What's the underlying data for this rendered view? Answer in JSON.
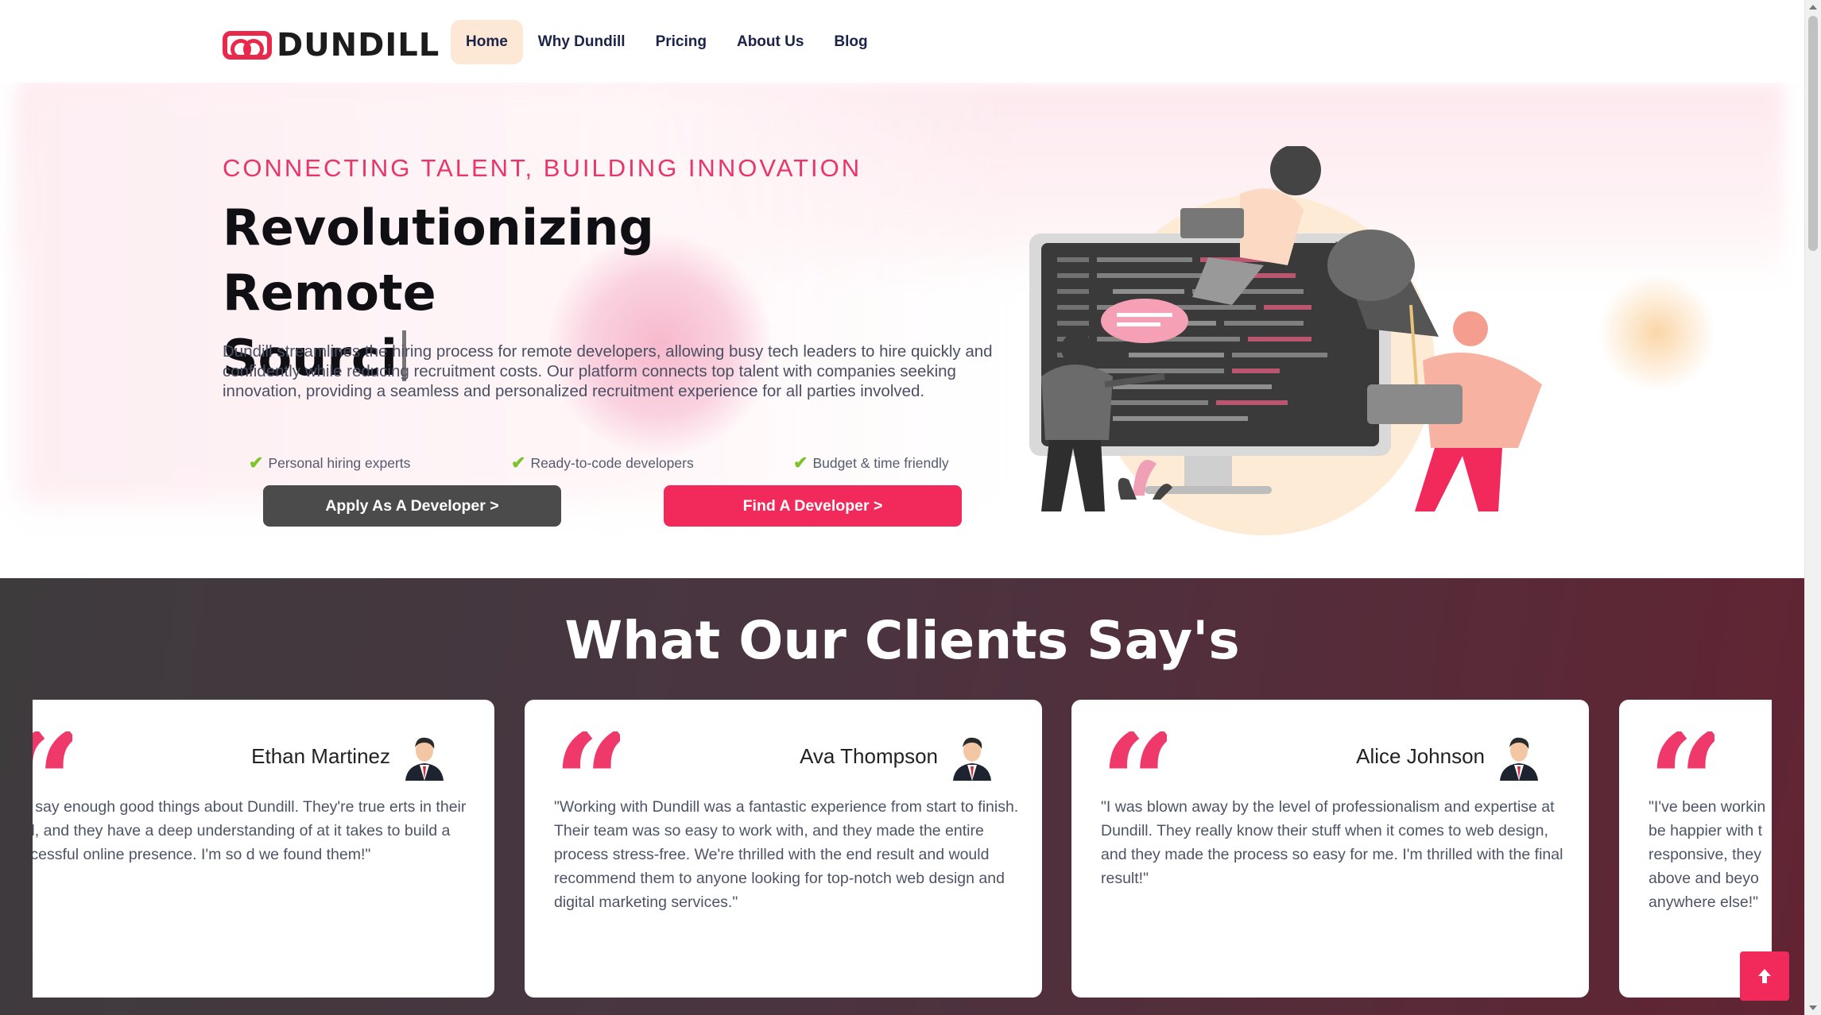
{
  "brand": {
    "name": "DUNDILL"
  },
  "nav": {
    "items": [
      {
        "label": "Home",
        "active": true
      },
      {
        "label": "Why Dundill"
      },
      {
        "label": "Pricing"
      },
      {
        "label": "About Us"
      },
      {
        "label": "Blog"
      }
    ]
  },
  "hero": {
    "eyebrow": "CONNECTING TALENT, BUILDING INNOVATION",
    "headline_line1": "Revolutionizing Remote",
    "headline_line2": "Sourci",
    "description": "Dundill streamlines the hiring process for remote developers, allowing busy tech leaders to hire quickly and confidently while reducing recruitment costs. Our platform connects top talent with companies seeking innovation, providing a seamless and personalized recruitment experience for all parties involved.",
    "features": [
      "Personal hiring experts",
      "Ready-to-code developers",
      "Budget & time friendly"
    ],
    "apply_button": "Apply As A Developer >",
    "find_button": "Find A Developer >"
  },
  "testimonials": {
    "title": "What Our Clients Say's",
    "cards": [
      {
        "name": "Ethan Martinez",
        "text": "an't say enough good things about Dundill. They're true erts in their field, and they have a deep understanding of at it takes to build a successful online presence. I'm so d we found them!\""
      },
      {
        "name": "Ava Thompson",
        "text": "\"Working with Dundill was a fantastic experience from start to finish. Their team was so easy to work with, and they made the entire process stress-free. We're thrilled with the end result and would recommend them to anyone looking for top-notch web design and digital marketing services.\""
      },
      {
        "name": "Alice Johnson",
        "text": "\"I was blown away by the level of professionalism and expertise at Dundill. They really know their stuff when it comes to web design, and they made the process so easy for me. I'm thrilled with the final result!\""
      },
      {
        "name": "",
        "text": "\"I've been workin be happier with t responsive, they above and beyo anywhere else!\""
      }
    ]
  },
  "icons": {
    "check": "check-icon",
    "quote": "quote-icon",
    "avatar": "avatar-icon",
    "scroll_top": "arrow-up-icon"
  },
  "colors": {
    "accent": "#f2295b",
    "dark_button": "#4b4b4b",
    "nav_active": "#fde8d6"
  }
}
